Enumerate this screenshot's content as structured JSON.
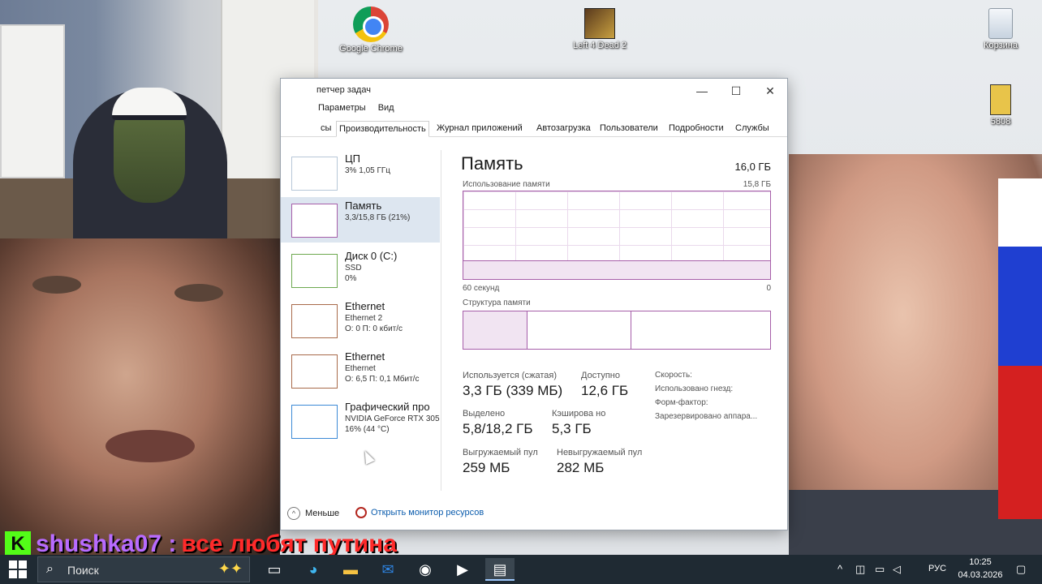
{
  "desktop": {
    "icons": [
      {
        "label": "Google Chrome",
        "icon": "chrome-icon"
      },
      {
        "label": "Left 4 Dead 2",
        "icon": "game-icon"
      },
      {
        "label": "Корзина",
        "icon": "recycle-bin-icon"
      },
      {
        "label": "5808",
        "icon": "file-icon"
      }
    ]
  },
  "task_manager": {
    "title": "петчер задач",
    "menu": [
      "Параметры",
      "Вид"
    ],
    "tabs": [
      "сы",
      "Производительность",
      "Журнал приложений",
      "Автозагрузка",
      "Пользователи",
      "Подробности",
      "Службы"
    ],
    "active_tab": "Производительность",
    "window_buttons": {
      "minimize": "—",
      "maximize": "☐",
      "close": "✕"
    },
    "sidebar": [
      {
        "name": "ЦП",
        "line1": "3% 1,05 ГГц",
        "line2": ""
      },
      {
        "name": "Память",
        "line1": "3,3/15,8 ГБ (21%)",
        "line2": ""
      },
      {
        "name": "Диск 0 (C:)",
        "line1": "SSD",
        "line2": "0%"
      },
      {
        "name": "Ethernet",
        "line1": "Ethernet 2",
        "line2": "О: 0 П: 0 кбит/с"
      },
      {
        "name": "Ethernet",
        "line1": "Ethernet",
        "line2": "О: 6,5 П: 0,1 Мбит/с"
      },
      {
        "name": "Графический про",
        "line1": "NVIDIA GeForce RTX 305",
        "line2": "16% (44 °C)"
      }
    ],
    "selected_item": "Память",
    "main": {
      "title": "Память",
      "total": "16,0 ГБ",
      "usage_label": "Использование памяти",
      "usage_max": "15,8 ГБ",
      "axis_left": "60 секунд",
      "axis_right": "0",
      "usage_fraction": 0.21,
      "structure_label": "Структура памяти",
      "stats": [
        {
          "label": "Используется (сжатая)",
          "value": "3,3 ГБ (339 МБ)"
        },
        {
          "label": "Доступно",
          "value": "12,6 ГБ"
        },
        {
          "label": "Выделено",
          "value": "5,8/18,2 ГБ"
        },
        {
          "label": "Кэширова но",
          "value": "5,3 ГБ"
        },
        {
          "label": "Выгружаемый пул",
          "value": "259 МБ"
        },
        {
          "label": "Невыгружаемый пул",
          "value": "282 МБ"
        }
      ],
      "props": [
        "Скорость:",
        "Использовано гнезд:",
        "Форм-фактор:",
        "Зарезервировано аппара..."
      ]
    },
    "footer": {
      "less": "Меньше",
      "monitor": "Открыть монитор ресурсов"
    }
  },
  "chat": {
    "badge": "K",
    "user": "shushka07 :",
    "message": "все любят путина"
  },
  "taskbar": {
    "search_placeholder": "Поиск",
    "apps": [
      "task-view-icon",
      "edge-icon",
      "file-explorer-icon",
      "outlook-icon",
      "obs-icon",
      "media-player-icon",
      "task-manager-icon"
    ],
    "language": "РУС",
    "time": "10:25",
    "date": "04.03.2026"
  }
}
